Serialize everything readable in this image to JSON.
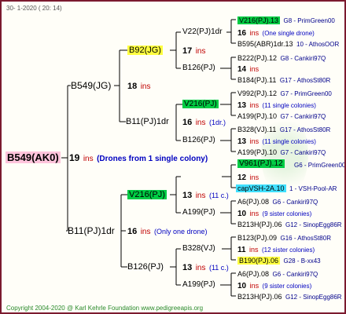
{
  "header": {
    "date_text": "30-   1-2020  ( 20:  14)"
  },
  "footer": {
    "copyright": "Copyright 2004-2020 @ Karl Kehrle Foundation   www.pedigreeapis.org"
  },
  "root": {
    "label": "B549(AK0)",
    "count": "19",
    "ins": "ins",
    "note": "(Drones from 1 single colony)"
  },
  "gen2": [
    {
      "label": "B549(JG)",
      "count": "18",
      "ins": "ins",
      "note": ""
    },
    {
      "label": "B11(PJ)1dr",
      "count": "16",
      "ins": "ins",
      "note": "(Only one drone)"
    }
  ],
  "gen3": [
    {
      "label": "B92(JG)",
      "count": "17",
      "ins": "ins",
      "note": ""
    },
    {
      "label": "B11(PJ)1dr",
      "count": "16",
      "ins": "ins",
      "note": "(1dr.)"
    },
    {
      "label": "V216(PJ)",
      "count": "13",
      "ins": "ins",
      "note": "(11 c.)"
    },
    {
      "label": "B126(PJ)",
      "count": "13",
      "ins": "ins",
      "note": "(11 c.)"
    }
  ],
  "gen4": [
    {
      "label": "V22(PJ)1dr",
      "count": "16",
      "ins": "ins",
      "note": "(One single drone)"
    },
    {
      "label": "B126(PJ)",
      "count": "14",
      "ins": "ins",
      "note": ""
    },
    {
      "label": "V216(PJ)",
      "count": "13",
      "ins": "ins",
      "note": "(11 single colonies)"
    },
    {
      "label": "B126(PJ)",
      "count": "13",
      "ins": "ins",
      "note": "(11 single colonies)"
    },
    {
      "label": "V961(PJ).12",
      "count": "12",
      "ins": "ins",
      "note": ""
    },
    {
      "label": "A199(PJ)",
      "count": "10",
      "ins": "ins",
      "note": "(9 sister colonies)"
    },
    {
      "label": "B328(VJ)",
      "count": "11",
      "ins": "ins",
      "note": "(12 sister colonies)"
    },
    {
      "label": "A199(PJ)",
      "count": "10",
      "ins": "ins",
      "note": "(9 sister colonies)"
    }
  ],
  "gen5": [
    {
      "label": "V216(PJ).13",
      "info": "G8 - PrimGreen00"
    },
    {
      "label": "B595(ABR)1dr.13",
      "info": "10 - AthosOOR"
    },
    {
      "label": "B222(PJ).12",
      "info": "G8 - Cankiri97Q"
    },
    {
      "label": "B184(PJ).11",
      "info": "G17 - AthosSt80R"
    },
    {
      "label": "V992(PJ).12",
      "info": "G7 - PrimGreen00"
    },
    {
      "label": "A199(PJ).10",
      "info": "G7 - Cankiri97Q"
    },
    {
      "label": "B328(VJ).11",
      "info": "G17 - AthosSt80R"
    },
    {
      "label": "A199(PJ).10",
      "info": "G7 - Cankiri97Q"
    },
    {
      "label": "V961(PJ).12",
      "info": "G6 - PrimGreen00"
    },
    {
      "label": "capVSH-2A.10",
      "info": "1 - VSH-Pool-AR"
    },
    {
      "label": "A6(PJ).08",
      "info": "G6 - Cankiri97Q"
    },
    {
      "label": "B213H(PJ).06",
      "info": "G12 - SinopEgg86R"
    },
    {
      "label": "B123(PJ).09",
      "info": "G16 - AthosSt80R"
    },
    {
      "label": "B190(PJ).06",
      "info": "G28 - B-xx43"
    },
    {
      "label": "A6(PJ).08",
      "info": "G6 - Cankiri97Q"
    },
    {
      "label": "B213H(PJ).06",
      "info": "G12 - SinopEgg86R"
    }
  ],
  "colors": {
    "border": "#7b1a2f",
    "ins": "#c00000",
    "note": "#0000c0",
    "info": "#00008b",
    "highlight_green": "#00cc44",
    "highlight_yellow": "#ffff40",
    "highlight_pink": "#ffc4dc",
    "highlight_cyan": "#40e0ff"
  }
}
